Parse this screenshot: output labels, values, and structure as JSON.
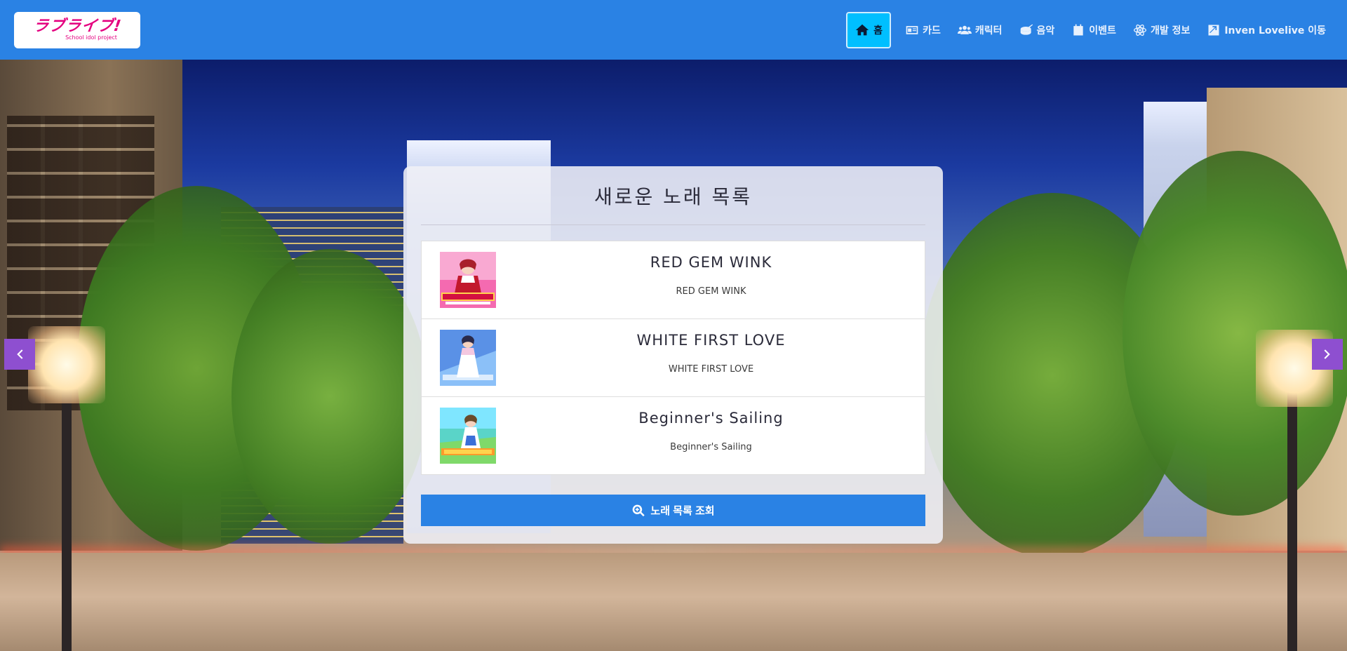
{
  "brand": {
    "logo_text": "ラブライブ!",
    "logo_subtitle": "School idol project"
  },
  "nav": {
    "items": [
      {
        "label": "홈",
        "icon": "home-icon",
        "active": true
      },
      {
        "label": "카드",
        "icon": "id-card-icon"
      },
      {
        "label": "캐릭터",
        "icon": "users-icon"
      },
      {
        "label": "음악",
        "icon": "drum-icon"
      },
      {
        "label": "이벤트",
        "icon": "calendar-icon"
      },
      {
        "label": "개발 정보",
        "icon": "atom-icon"
      },
      {
        "label": "Inven Lovelive 이동",
        "icon": "external-link-icon"
      }
    ]
  },
  "carousel": {
    "prev_icon": "chevron-left-icon",
    "next_icon": "chevron-right-icon"
  },
  "panel": {
    "title": "새로운 노래 목록",
    "songs": [
      {
        "title": "RED GEM WINK",
        "subtitle": "RED GEM WINK"
      },
      {
        "title": "WHITE FIRST LOVE",
        "subtitle": "WHITE FIRST LOVE"
      },
      {
        "title": "Beginner's Sailing",
        "subtitle": "Beginner's Sailing"
      }
    ],
    "search_button_label": "노래 목록 조회",
    "search_button_icon": "search-plus-icon"
  },
  "colors": {
    "navbar": "#2a82e4",
    "active_nav": "#00bfff",
    "arrow": "#8e4fd0",
    "logo_pink": "#e4007f"
  }
}
